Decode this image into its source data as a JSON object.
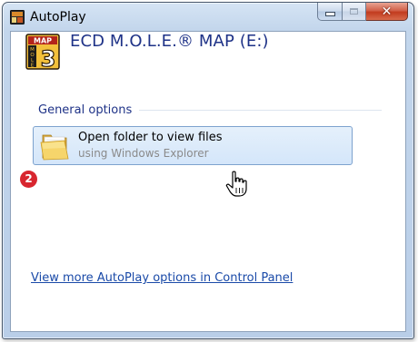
{
  "window": {
    "title": "AutoPlay",
    "minimize_icon": "minimize-icon",
    "maximize_icon": "maximize-icon",
    "close_icon": "close-icon"
  },
  "device": {
    "name": "ECD M.O.L.E.® MAP (E:)",
    "icon": "mole-map-disc-icon",
    "icon_text": [
      "MAP",
      "M",
      "O",
      "L",
      "E",
      "3"
    ]
  },
  "sections": [
    {
      "title": "General options",
      "options": [
        {
          "title": "Open folder to view files",
          "subtitle": "using Windows Explorer",
          "icon": "folder-icon"
        }
      ]
    }
  ],
  "annotation": {
    "badge": "2",
    "cursor": "hand-cursor-icon"
  },
  "footer": {
    "link_text": "View more AutoPlay options in Control Panel"
  },
  "colors": {
    "heading": "#1e3287",
    "link": "#1a4aa8",
    "badge": "#d8262f",
    "option_highlight": "#d4e6fa"
  }
}
